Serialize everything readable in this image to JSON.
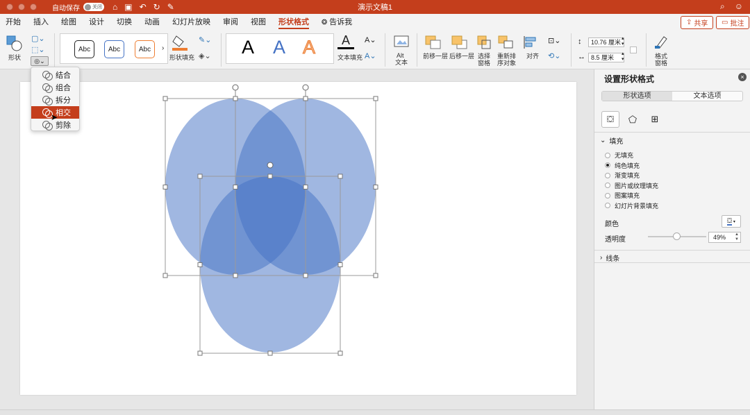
{
  "titlebar": {
    "autosave_label": "自动保存",
    "autosave_state": "关闭",
    "doc_title": "演示文稿1"
  },
  "tabs": [
    {
      "label": "开始",
      "active": false
    },
    {
      "label": "插入",
      "active": false
    },
    {
      "label": "绘图",
      "active": false
    },
    {
      "label": "设计",
      "active": false
    },
    {
      "label": "切换",
      "active": false
    },
    {
      "label": "动画",
      "active": false
    },
    {
      "label": "幻灯片放映",
      "active": false
    },
    {
      "label": "审阅",
      "active": false
    },
    {
      "label": "视图",
      "active": false
    },
    {
      "label": "形状格式",
      "active": true
    },
    {
      "label": "告诉我",
      "active": false
    }
  ],
  "header_buttons": {
    "share": "共享",
    "comment": "批注"
  },
  "ribbon": {
    "shape_label": "形状",
    "style_samples": [
      "Abc",
      "Abc",
      "Abc"
    ],
    "shape_fill_label": "形状填充",
    "wordart_samples": [
      "A",
      "A",
      "A"
    ],
    "text_fill_label": "文本填充",
    "alt_text_label_1": "Alt",
    "alt_text_label_2": "文本",
    "bring_forward_label": "前移一层",
    "send_backward_label": "后移一层",
    "selection_pane_label_1": "选择",
    "selection_pane_label_2": "窗格",
    "reorder_label_1": "重新排",
    "reorder_label_2": "序对象",
    "align_label": "对齐",
    "height_value": "10.76 厘米",
    "width_value": "8.5 厘米",
    "format_pane_label_1": "格式",
    "format_pane_label_2": "窗格"
  },
  "merge_menu": {
    "items": [
      {
        "label": "结合",
        "active": false
      },
      {
        "label": "组合",
        "active": false
      },
      {
        "label": "拆分",
        "active": false
      },
      {
        "label": "相交",
        "active": true
      },
      {
        "label": "剪除",
        "active": false
      }
    ]
  },
  "slide": {
    "shape_color": "#4472c4",
    "shape_opacity": 0.51
  },
  "format_pane": {
    "title": "设置形状格式",
    "tab_shape": "形状选项",
    "tab_text": "文本选项",
    "fill_section": "填充",
    "fill_options": [
      {
        "label": "无填充",
        "selected": false
      },
      {
        "label": "纯色填充",
        "selected": true
      },
      {
        "label": "渐变填充",
        "selected": false
      },
      {
        "label": "图片或纹理填充",
        "selected": false
      },
      {
        "label": "图案填充",
        "selected": false
      },
      {
        "label": "幻灯片背景填充",
        "selected": false
      }
    ],
    "color_label": "颜色",
    "transparency_label": "透明度",
    "transparency_value": "49%",
    "transparency_fraction": 0.49,
    "line_section": "线条"
  },
  "colors": {
    "accent": "#c43e1c",
    "shape_fill": "#4472c4"
  }
}
